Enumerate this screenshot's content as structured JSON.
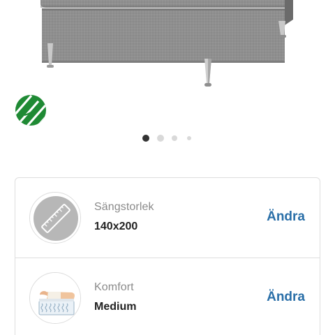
{
  "gallery": {
    "product_image_icon": "gray-box-spring-bed-image",
    "eco_badge_icon": "nordic-swan-ecolabel-icon",
    "dots_total": 4,
    "active_dot": 0
  },
  "options": [
    {
      "icon": "ruler-size-icon",
      "label": "Sängstorlek",
      "value": "140x200",
      "action_label": "Ändra"
    },
    {
      "icon": "mattress-comfort-icon",
      "label": "Komfort",
      "value": "Medium",
      "action_label": "Ändra"
    }
  ],
  "colors": {
    "accent": "#2a6fa8",
    "eco_green": "#1f8a34",
    "fabric_gray": "#8e8e8e"
  }
}
